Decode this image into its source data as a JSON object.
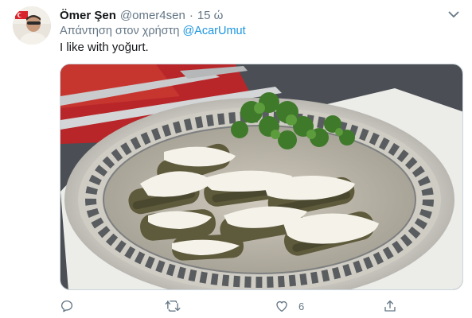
{
  "tweet": {
    "author_name": "Ömer Şen",
    "author_handle": "@omer4sen",
    "separator": "·",
    "timestamp": "15 ώ",
    "reply_prefix": "Απάντηση στον χρήστη",
    "reply_mention": "@AcarUmut",
    "text": "I like with yoğurt.",
    "media": {
      "description_icon": "photo-sarma-with-yogurt"
    },
    "actions": {
      "reply_count": "",
      "retweet_count": "",
      "like_count": "6",
      "share_count": ""
    }
  },
  "colors": {
    "text_primary": "#14171a",
    "text_secondary": "#657786",
    "link": "#1b95e0",
    "border": "#ccd6dd"
  }
}
